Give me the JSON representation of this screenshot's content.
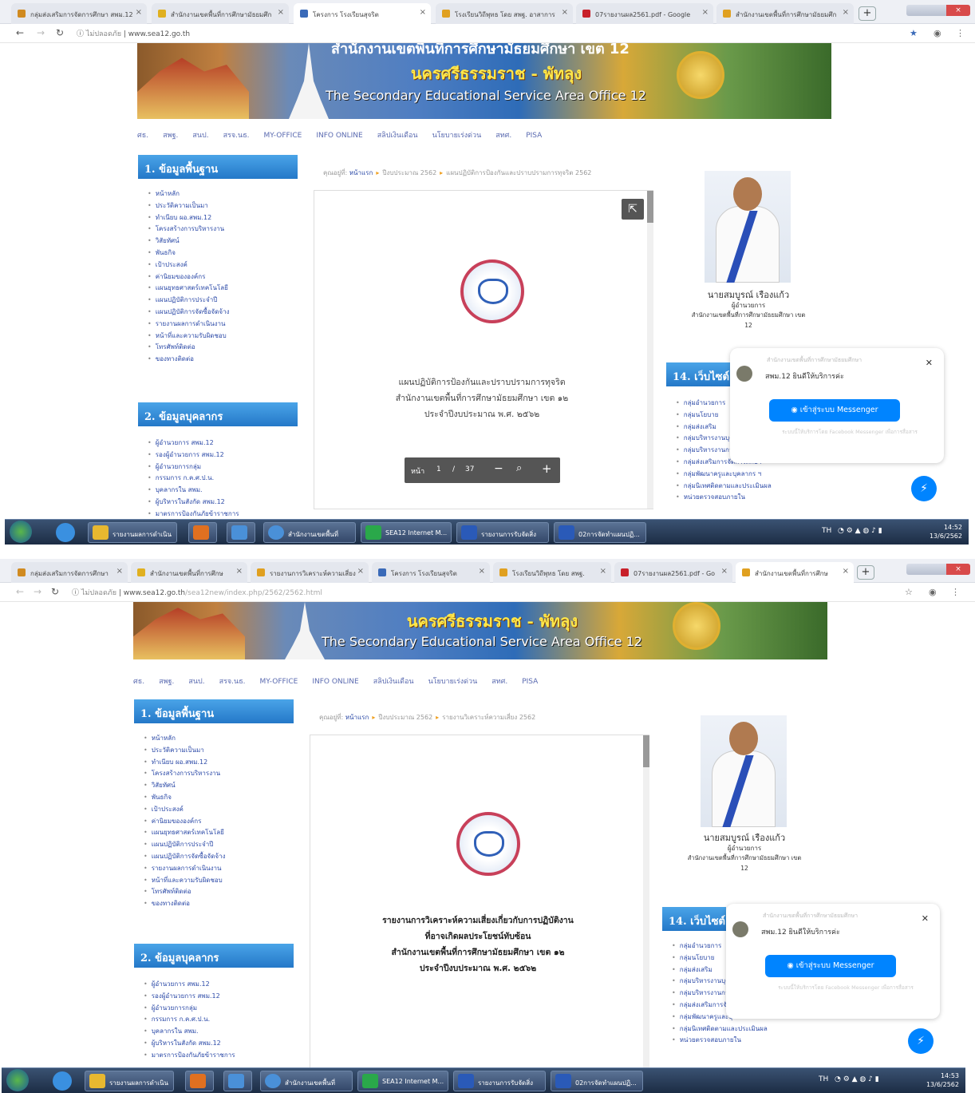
{
  "shot1": {
    "tabs": [
      {
        "label": "กลุ่มส่งเสริมการจัดการศึกษา สพม.12",
        "color": "#d08a20"
      },
      {
        "label": "สำนักงานเขตพื้นที่การศึกษามัธยมศึก",
        "color": "#e0b020"
      },
      {
        "label": "โครงการ โรงเรียนสุจริต",
        "color": "#3a6ab8"
      },
      {
        "label": "โรงเรียนวิถีพุทธ โดย สพฐ. อาสาการ",
        "color": "#e0a020"
      },
      {
        "label": "07รายงานผล2561.pdf - Google",
        "color": "#c8202a"
      },
      {
        "label": "สำนักงานเขตพื้นที่การศึกษามัธยมศึก",
        "color": "#e0a020"
      }
    ],
    "url_prefix": "ไม่ปลอดภัย",
    "url_domain": "www.sea12.go.th",
    "url_path": "",
    "breadcrumb": {
      "label": "คุณอยู่ที่:",
      "items": [
        "หน้าแรก",
        "ปีงบประมาณ 2562",
        "แผนปฏิบัติการป้องกันและปราบปรามการทุจริต 2562"
      ]
    },
    "doc_lines": [
      "แผนปฏิบัติการป้องกันและปราบปรามการทุจริต",
      "สำนักงานเขตพื้นที่การศึกษามัธยมศึกษา เขต ๑๒",
      "ประจำปีงบประมาณ พ.ศ. ๒๕๖๒"
    ],
    "pager": {
      "label": "หน้า",
      "current": "1",
      "sep": "/",
      "total": "37"
    },
    "clock_time": "14:52",
    "clock_date": "13/6/2562"
  },
  "shot2": {
    "tabs": [
      {
        "label": "กลุ่มส่งเสริมการจัดการศึกษา",
        "color": "#d08a20"
      },
      {
        "label": "สำนักงานเขตพื้นที่การศึกษ",
        "color": "#e0b020"
      },
      {
        "label": "รายงานการวิเคราะห์ความเสี่ยง",
        "color": "#e0a020"
      },
      {
        "label": "โครงการ โรงเรียนสุจริต",
        "color": "#3a6ab8"
      },
      {
        "label": "โรงเรียนวิถีพุทธ โดย สพฐ.",
        "color": "#e0a020"
      },
      {
        "label": "07รายงานผล2561.pdf - Go",
        "color": "#c8202a"
      },
      {
        "label": "สำนักงานเขตพื้นที่การศึกษ",
        "color": "#e0a020"
      }
    ],
    "url_prefix": "ไม่ปลอดภัย",
    "url_domain": "www.sea12.go.th",
    "url_path": "/sea12new/index.php/2562/2562.html",
    "breadcrumb": {
      "label": "คุณอยู่ที่:",
      "items": [
        "หน้าแรก",
        "ปีงบประมาณ 2562",
        "รายงานวิเคราะห์ความเสี่ยง 2562"
      ]
    },
    "doc_lines": [
      "รายงานการวิเคราะห์ความเสี่ยงเกี่ยวกับการปฏิบัติงาน",
      "ที่อาจเกิดผลประโยชน์ทับซ้อน",
      "สำนักงานเขตพื้นที่การศึกษามัธยมศึกษา เขต ๑๒",
      "ประจำปีงบประมาณ พ.ศ. ๒๕๖๒"
    ],
    "clock_time": "14:53",
    "clock_date": "13/6/2562"
  },
  "banner": {
    "top": "สำนักงานเขตพื้นที่การศึกษามัธยมศึกษา เขต 12",
    "thai": "นครศรีธรรมราช - พัทลุง",
    "english": "The Secondary Educational Service Area Office 12"
  },
  "menu": [
    "ศธ.",
    "สพฐ.",
    "สนป.",
    "สรจ.นธ.",
    "MY-OFFICE",
    "INFO ONLINE",
    "สลิปเงินเดือน",
    "นโยบายเร่งด่วน",
    "สทศ.",
    "PISA"
  ],
  "section1": {
    "title": "1. ข้อมูลพื้นฐาน",
    "items": [
      "หน้าหลัก",
      "ประวัติความเป็นมา",
      "ทำเนียบ ผอ.สพม.12",
      "โครงสร้างการบริหารงาน",
      "วิสัยทัศน์",
      "พันธกิจ",
      "เป้าประสงค์",
      "ค่านิยมขององค์กร",
      "แผนยุทธศาสตร์เทคโนโลยี",
      "แผนปฏิบัติการประจำปี",
      "แผนปฏิบัติการจัดซื้อจัดจ้าง",
      "รายงานผลการดำเนินงาน",
      "หน้าที่และความรับผิดชอบ",
      "โทรศัพท์ติดต่อ",
      "ของทางติดต่อ"
    ]
  },
  "section2": {
    "title": "2. ข้อมูลบุคลากร",
    "items": [
      "ผู้อำนวยการ สพม.12",
      "รองผู้อำนวยการ สพม.12",
      "ผู้อำนวยการกลุ่ม",
      "กรรมการ ก.ค.ศ.ป.น.",
      "บุคลากรใน สพม.",
      "ผู้บริหารในสังกัด สพม.12",
      "มาตรการป้องกันภัยข้าราชการ"
    ]
  },
  "director": {
    "name": "นายสมบูรณ์ เรืองแก้ว",
    "role": "ผู้อำนวยการ",
    "org": "สำนักงานเขตพื้นที่การศึกษามัธยมศึกษา เขต",
    "org_num": "12"
  },
  "section14": {
    "title": "14. เว็บไซต์",
    "items": [
      "กลุ่มอำนวยการ",
      "กลุ่มนโยบาย",
      "กลุ่มส่งเสริม",
      "กลุ่มบริหารงานบุคคล",
      "กลุ่มบริหารงานการเงิน",
      "กลุ่มส่งเสริมการจัดการศึกษา",
      "กลุ่มพัฒนาครูและบุคลากร ฯ",
      "กลุ่มนิเทศติดตามและประเมินผล",
      "หน่วยตรวจสอบภายใน"
    ]
  },
  "chat": {
    "page_name": "สำนักงานเขตพื้นที่การศึกษามัธยมศึกษา",
    "greeting": "สพม.12 ยินดีให้บริการค่ะ",
    "button": "เข้าสู่ระบบ Messenger",
    "note": "ระบบนี้ให้บริการโดย Facebook Messenger เพื่อการสื่อสาร"
  },
  "taskbar": {
    "items": [
      {
        "label": "รายงานผลการดำเนิน",
        "color": "#e8b830"
      },
      {
        "label": "",
        "color": "#e07020"
      },
      {
        "label": "",
        "color": "#4a90d8"
      },
      {
        "label": "สำนักงานเขตพื้นที่",
        "color": "#4a90d8"
      },
      {
        "label": "SEA12 Internet M...",
        "color": "#2aa84a"
      },
      {
        "label": "รายงานการรับจัดสิ่ง",
        "color": "#2a5ab8"
      },
      {
        "label": "02การจัดทำแผนปฏิ...",
        "color": "#2a5ab8"
      }
    ],
    "lang": "TH"
  }
}
